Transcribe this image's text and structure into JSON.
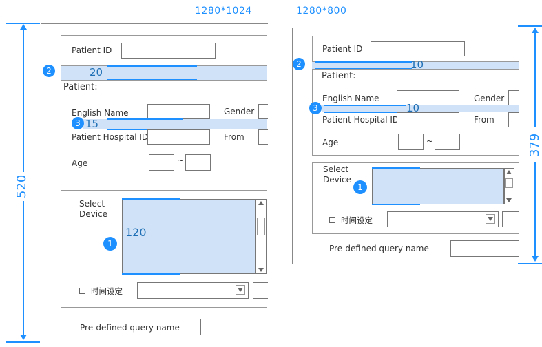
{
  "left": {
    "resolution": "1280*1024",
    "height_label": "520",
    "patient_id": "Patient ID",
    "patient": "Patient:",
    "english_name": "English Name",
    "gender": "Gender",
    "hospital_id": "Patient Hospital ID",
    "from": "From",
    "age": "Age",
    "tilde": "~",
    "select": "Select",
    "device": "Device",
    "time_setting": "时间设定",
    "predefined": "Pre-defined query name",
    "spacing_patient": "20",
    "spacing_rows": "15",
    "device_list_height": "120",
    "badge_1": "1",
    "badge_2": "2",
    "badge_3": "3"
  },
  "right": {
    "resolution": "1280*800",
    "height_label": "379",
    "patient_id": "Patient ID",
    "patient": "Patient:",
    "english_name": "English Name",
    "gender": "Gender",
    "hospital_id": "Patient Hospital ID",
    "from": "From",
    "age": "Age",
    "tilde": "~",
    "select": "Select",
    "device": "Device",
    "time_setting": "时间设定",
    "predefined": "Pre-defined query name",
    "spacing_patient": "10",
    "spacing_rows": "10",
    "badge_1": "1",
    "badge_2": "2",
    "badge_3": "3"
  },
  "colors": {
    "accent": "#1E90FF",
    "highlight": "#CFE2F7"
  }
}
